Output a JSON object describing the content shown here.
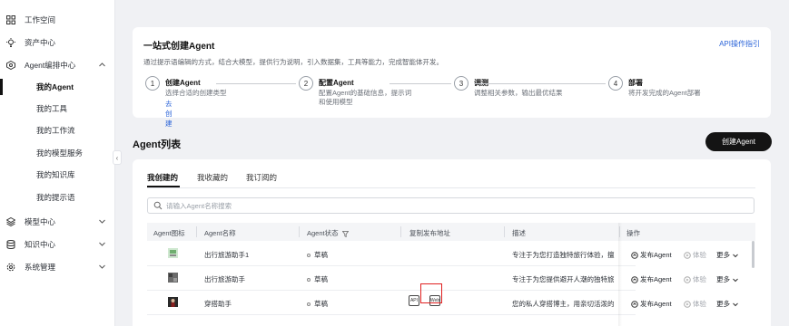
{
  "sidebar": {
    "items": [
      {
        "label": "工作空间",
        "icon": "grid-icon"
      },
      {
        "label": "资产中心",
        "icon": "bulb-icon"
      },
      {
        "label": "Agent编排中心",
        "icon": "agent-icon",
        "expanded": true
      },
      {
        "label": "模型中心",
        "icon": "model-icon"
      },
      {
        "label": "知识中心",
        "icon": "knowledge-icon"
      },
      {
        "label": "系统管理",
        "icon": "settings-icon"
      }
    ],
    "sub_items": [
      "我的Agent",
      "我的工具",
      "我的工作流",
      "我的模型服务",
      "我的知识库",
      "我的提示语"
    ],
    "active_sub": "我的Agent"
  },
  "intro": {
    "title": "一站式创建Agent",
    "subtitle": "通过提示语编辑的方式，结合大模型，提供行为说明，引入数据集，工具等能力，完成智能体开发。",
    "api_link": "API操作指引",
    "steps": [
      {
        "num": "1",
        "title": "创建Agent",
        "desc": "选择合适的创建类型",
        "link": "去创建"
      },
      {
        "num": "2",
        "title": "配置Agent",
        "desc": "配置Agent的基础信息，提示词",
        "desc2": "和使用模型"
      },
      {
        "num": "3",
        "title": "调测",
        "desc": "调整相关参数，输出最优结果"
      },
      {
        "num": "4",
        "title": "部署",
        "desc": "将开发完成的Agent部署"
      }
    ]
  },
  "list": {
    "title": "Agent列表",
    "create_button": "创建Agent",
    "tabs": [
      "我创建的",
      "我收藏的",
      "我订阅的"
    ],
    "active_tab": "我创建的",
    "search_placeholder": "请输入Agent名称搜索",
    "columns": [
      "Agent图标",
      "Agent名称",
      "Agent状态",
      "复制发布地址",
      "描述",
      "操作"
    ],
    "rows": [
      {
        "name": "出行旅游助手1",
        "status": "草稿",
        "description": "专注于为您打造独特旅行体验，擅"
      },
      {
        "name": "出行旅游助手",
        "status": "草稿",
        "description": "专注于为您提供避开人潮的独特旅"
      },
      {
        "name": "穿搭助手",
        "status": "草稿",
        "description": "您的私人穿搭博主，用亲切活泼的"
      }
    ],
    "actions": {
      "publish": "发布Agent",
      "test": "体验",
      "more": "更多"
    },
    "colors": {
      "accent": "#2a63d8",
      "highlight": "#e02020"
    }
  }
}
